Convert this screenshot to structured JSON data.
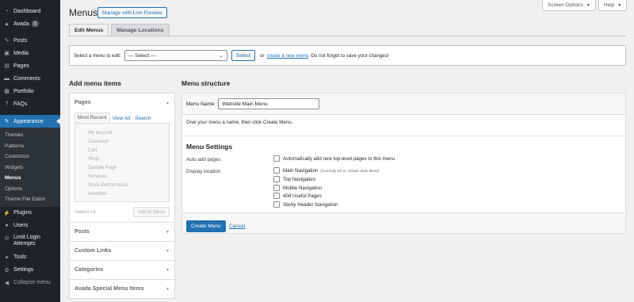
{
  "sidebar": {
    "items": [
      {
        "label": "Dashboard",
        "icon": "dashboard-icon",
        "glyph": "◔"
      },
      {
        "label": "Avada",
        "icon": "avada-icon",
        "glyph": "▲",
        "badge": "1"
      },
      {
        "label": "Posts",
        "icon": "pin-icon",
        "glyph": "✎"
      },
      {
        "label": "Media",
        "icon": "media-icon",
        "glyph": "▣"
      },
      {
        "label": "Pages",
        "icon": "pages-icon",
        "glyph": "▤"
      },
      {
        "label": "Comments",
        "icon": "comment-icon",
        "glyph": "▬"
      },
      {
        "label": "Portfolio",
        "icon": "portfolio-icon",
        "glyph": "▦"
      },
      {
        "label": "FAQs",
        "icon": "faq-icon",
        "glyph": "?"
      },
      {
        "label": "Appearance",
        "icon": "brush-icon",
        "glyph": "✎"
      }
    ],
    "submenu": [
      "Themes",
      "Patterns",
      "Customize",
      "Widgets",
      "Menus",
      "Options",
      "Theme File Editor"
    ],
    "items_after": [
      {
        "label": "Plugins",
        "icon": "plugin-icon",
        "glyph": "⚡"
      },
      {
        "label": "Users",
        "icon": "users-icon",
        "glyph": "●"
      },
      {
        "label": "Limit Login Attempts",
        "icon": "lock-icon",
        "glyph": "◎"
      },
      {
        "label": "Tools",
        "icon": "wrench-icon",
        "glyph": "✦"
      },
      {
        "label": "Settings",
        "icon": "settings-icon",
        "glyph": "⚙"
      },
      {
        "label": "Collapse menu",
        "icon": "collapse-icon",
        "glyph": "◀"
      }
    ]
  },
  "header": {
    "title": "Menus",
    "live_preview": "Manage with Live Preview",
    "screen_options": "Screen Options",
    "help": "Help",
    "arrow": "▼"
  },
  "tabs": [
    "Edit Menus",
    "Manage Locations"
  ],
  "select_bar": {
    "label": "Select a menu to edit:",
    "selected": "— Select —",
    "select_button": "Select",
    "or": "or",
    "create_link": "create a new menu",
    "tail": ". Do not forget to save your changes!"
  },
  "add_items": {
    "heading": "Add menu items",
    "pages_title": "Pages",
    "page_tabs": [
      "Most Recent",
      "View All",
      "Search"
    ],
    "pages": [
      "My account",
      "Checkout",
      "Cart",
      "Shop",
      "Sample Page",
      "Services",
      "Stock Performance",
      "Investors"
    ],
    "select_all": "Select All",
    "add_to_menu": "Add to Menu",
    "sections": [
      "Posts",
      "Custom Links",
      "Categories",
      "Avada Special Menu Items"
    ]
  },
  "structure": {
    "heading": "Menu structure",
    "name_label": "Menu Name",
    "name_value": "Website Main Menu",
    "hint": "Give your menu a name, then click Create Menu.",
    "settings_heading": "Menu Settings",
    "auto_add_label": "Auto add pages",
    "auto_add_text": "Automatically add new top-level pages to this menu",
    "display_label": "Display location",
    "locations": [
      {
        "label": "Main Navigation",
        "note": "(Currently set to: Classic Main Menu)"
      },
      {
        "label": "Top Navigation",
        "note": ""
      },
      {
        "label": "Mobile Navigation",
        "note": ""
      },
      {
        "label": "404 Useful Pages",
        "note": ""
      },
      {
        "label": "Sticky Header Navigation",
        "note": ""
      }
    ],
    "create_button": "Create Menu",
    "cancel": "Cancel"
  }
}
